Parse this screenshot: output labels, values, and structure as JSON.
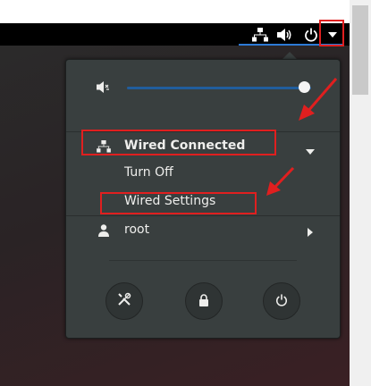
{
  "volume": {
    "level": 0.96
  },
  "network": {
    "status_label": "Wired Connected",
    "items": [
      {
        "label": "Turn Off"
      },
      {
        "label": "Wired Settings"
      }
    ]
  },
  "user": {
    "name": "root"
  },
  "icons": {
    "tray": [
      "network-wired-icon",
      "volume-icon",
      "power-icon",
      "dropdown-arrow-icon"
    ],
    "actions": [
      "settings-tools-icon",
      "lock-icon",
      "power-off-icon"
    ]
  },
  "colors": {
    "accent": "#2d7ad6",
    "menu_bg": "#393f3f",
    "annotation_red": "#e01f1f"
  }
}
